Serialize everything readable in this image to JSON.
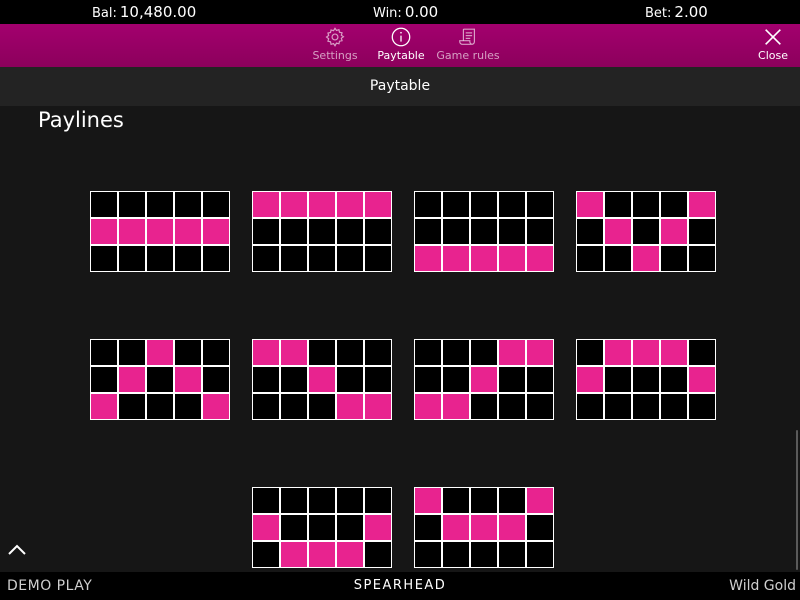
{
  "topbar": {
    "balance_label": "Bal:",
    "balance_value": "10,480.00",
    "win_label": "Win:",
    "win_value": "0.00",
    "bet_label": "Bet:",
    "bet_value": "2.00"
  },
  "menu": {
    "tabs": [
      {
        "label": "Settings",
        "icon": "gear-icon",
        "active": false
      },
      {
        "label": "Paytable",
        "icon": "info-icon",
        "active": true
      },
      {
        "label": "Game rules",
        "icon": "scroll-icon",
        "active": false
      }
    ],
    "close_label": "Close"
  },
  "page_title": "Paytable",
  "section_title": "Paylines",
  "paylines": [
    [
      [
        0,
        0,
        0,
        0,
        0
      ],
      [
        1,
        1,
        1,
        1,
        1
      ],
      [
        0,
        0,
        0,
        0,
        0
      ]
    ],
    [
      [
        1,
        1,
        1,
        1,
        1
      ],
      [
        0,
        0,
        0,
        0,
        0
      ],
      [
        0,
        0,
        0,
        0,
        0
      ]
    ],
    [
      [
        0,
        0,
        0,
        0,
        0
      ],
      [
        0,
        0,
        0,
        0,
        0
      ],
      [
        1,
        1,
        1,
        1,
        1
      ]
    ],
    [
      [
        1,
        0,
        0,
        0,
        1
      ],
      [
        0,
        1,
        0,
        1,
        0
      ],
      [
        0,
        0,
        1,
        0,
        0
      ]
    ],
    [
      [
        0,
        0,
        1,
        0,
        0
      ],
      [
        0,
        1,
        0,
        1,
        0
      ],
      [
        1,
        0,
        0,
        0,
        1
      ]
    ],
    [
      [
        1,
        1,
        0,
        0,
        0
      ],
      [
        0,
        0,
        1,
        0,
        0
      ],
      [
        0,
        0,
        0,
        1,
        1
      ]
    ],
    [
      [
        0,
        0,
        0,
        1,
        1
      ],
      [
        0,
        0,
        1,
        0,
        0
      ],
      [
        1,
        1,
        0,
        0,
        0
      ]
    ],
    [
      [
        0,
        1,
        1,
        1,
        0
      ],
      [
        1,
        0,
        0,
        0,
        1
      ],
      [
        0,
        0,
        0,
        0,
        0
      ]
    ],
    [
      [
        0,
        0,
        0,
        0,
        0
      ],
      [
        1,
        0,
        0,
        0,
        1
      ],
      [
        0,
        1,
        1,
        1,
        0
      ]
    ],
    [
      [
        1,
        0,
        0,
        0,
        1
      ],
      [
        0,
        1,
        1,
        1,
        0
      ],
      [
        0,
        0,
        0,
        0,
        0
      ]
    ]
  ],
  "footer": {
    "mode": "DEMO PLAY",
    "brand": "SPEARHEAD",
    "game": "Wild Gold"
  },
  "colors": {
    "accent": "#e8238f",
    "menubar": "#9a0066",
    "background": "#161616"
  }
}
